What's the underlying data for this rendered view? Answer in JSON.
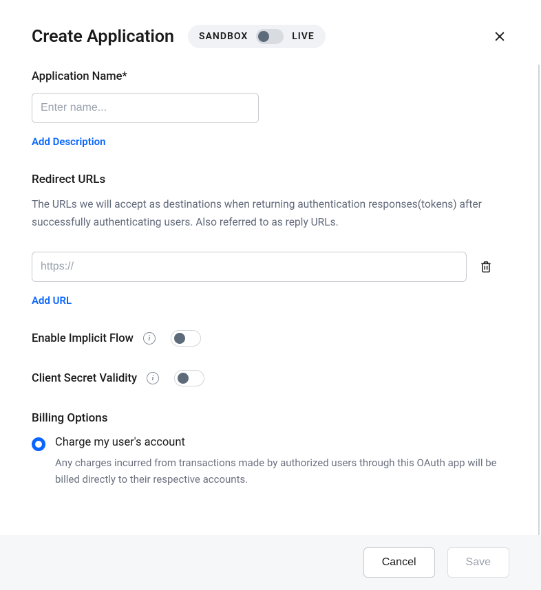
{
  "header": {
    "title": "Create Application",
    "env_sandbox": "SANDBOX",
    "env_live": "LIVE"
  },
  "app_name": {
    "label": "Application Name*",
    "placeholder": "Enter name...",
    "value": ""
  },
  "links": {
    "add_description": "Add Description",
    "add_url": "Add URL"
  },
  "redirect": {
    "heading": "Redirect URLs",
    "help": "The URLs we will accept as destinations when returning authentication responses(tokens) after successfully authenticating users. Also referred to as reply URLs.",
    "placeholder": "https://",
    "value": ""
  },
  "toggles": {
    "implicit_flow": "Enable Implicit Flow",
    "client_secret": "Client Secret Validity"
  },
  "billing": {
    "heading": "Billing Options",
    "option1_title": "Charge my user's account",
    "option1_desc": "Any charges incurred from transactions made by authorized users through this OAuth app will be billed directly to their respective accounts."
  },
  "footer": {
    "cancel": "Cancel",
    "save": "Save"
  }
}
